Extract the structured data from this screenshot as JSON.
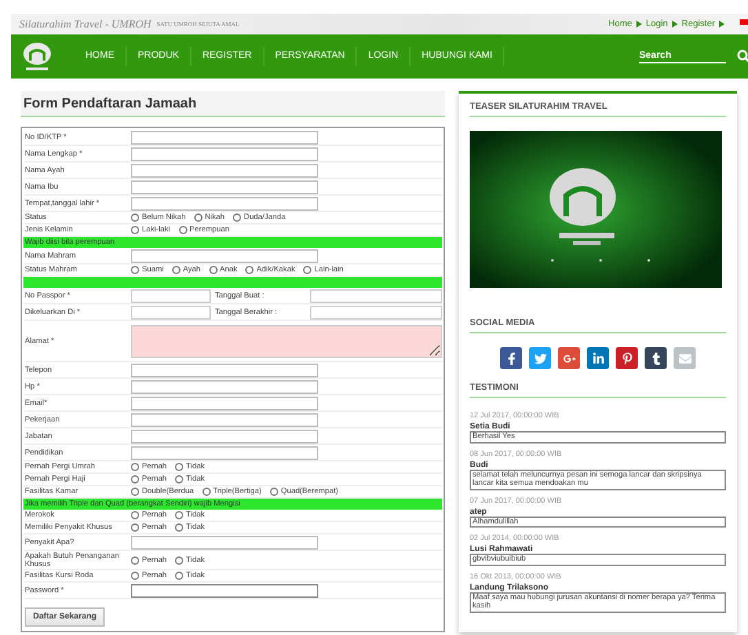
{
  "header": {
    "site_title": "Silaturahim Travel - UMROH",
    "tagline": "SATU UMROH SEJUTA AMAL",
    "top_links": [
      "Home",
      "Login",
      "Register"
    ]
  },
  "nav": {
    "items": [
      "HOME",
      "PRODUK",
      "REGISTER",
      "PERSYARATAN",
      "LOGIN",
      "HUBUNGI KAMI"
    ],
    "search": {
      "placeholder": "Search"
    }
  },
  "form": {
    "title": "Form Pendaftaran Jamaah",
    "rows": [
      {
        "kind": "text",
        "label": "No ID/KTP *"
      },
      {
        "kind": "text",
        "label": "Nama Lengkap *"
      },
      {
        "kind": "text",
        "label": "Nama Ayah"
      },
      {
        "kind": "text",
        "label": "Nama Ibu"
      },
      {
        "kind": "text",
        "label": "Tempat,tanggal lahir *"
      },
      {
        "kind": "radio",
        "label": "Status",
        "options": [
          {
            "label": "Belum Nikah",
            "selected": false
          },
          {
            "label": "Nikah",
            "selected": false
          },
          {
            "label": "Duda/Janda",
            "selected": false
          }
        ]
      },
      {
        "kind": "radio",
        "label": "Jenis Kelamin",
        "options": [
          {
            "label": "Laki-laki",
            "selected": false
          },
          {
            "label": "Perempuan",
            "selected": false
          }
        ]
      },
      {
        "kind": "banner",
        "text": "Wajib diisi bila perempuan"
      },
      {
        "kind": "text",
        "label": "Nama Mahram"
      },
      {
        "kind": "radio",
        "label": "Status Mahram",
        "options": [
          {
            "label": "Suami",
            "selected": false
          },
          {
            "label": "Ayah",
            "selected": false
          },
          {
            "label": "Anak",
            "selected": false
          },
          {
            "label": "Adik/Kakak",
            "selected": false
          },
          {
            "label": "Lain-lain",
            "selected": false
          }
        ]
      },
      {
        "kind": "divider"
      },
      {
        "kind": "pair",
        "label": "No Passpor *",
        "label_2": "Tanggal Buat :"
      },
      {
        "kind": "pair",
        "label": "Dikeluarkan Di *",
        "label_2": "Tanggal Berakhir :"
      },
      {
        "kind": "textarea",
        "label": "Alamat *"
      },
      {
        "kind": "text",
        "label": "Telepon"
      },
      {
        "kind": "text",
        "label": "Hp *"
      },
      {
        "kind": "text",
        "label": "Email*"
      },
      {
        "kind": "text",
        "label": "Pekerjaan"
      },
      {
        "kind": "text",
        "label": "Jabatan"
      },
      {
        "kind": "text",
        "label": "Pendidikan"
      },
      {
        "kind": "radio",
        "label": "Pernah Pergi Umrah",
        "options": [
          {
            "label": "Pernah",
            "selected": false
          },
          {
            "label": "Tidak",
            "selected": false
          }
        ]
      },
      {
        "kind": "radio",
        "label": "Pernah Pergi Haji",
        "options": [
          {
            "label": "Pernah",
            "selected": false
          },
          {
            "label": "Tidak",
            "selected": false
          }
        ]
      },
      {
        "kind": "radio",
        "label": "Fasilitas Kamar",
        "options": [
          {
            "label": "Double(Berdua",
            "selected": false
          },
          {
            "label": "Triple(Bertiga)",
            "selected": false
          },
          {
            "label": "Quad(Berempat)",
            "selected": false
          }
        ]
      },
      {
        "kind": "banner",
        "text": "Jika memilih Triple dan Quad (berangkat Sendiri) wajib Mengisi"
      },
      {
        "kind": "radio",
        "label": "Merokok",
        "options": [
          {
            "label": "Pernah",
            "selected": false
          },
          {
            "label": "Tidak",
            "selected": false
          }
        ]
      },
      {
        "kind": "radio",
        "label": "Memiliki Penyakit Khusus",
        "options": [
          {
            "label": "Pernah",
            "selected": false
          },
          {
            "label": "Tidak",
            "selected": false
          }
        ]
      },
      {
        "kind": "text",
        "label": "Penyakit Apa?"
      },
      {
        "kind": "radio",
        "label": "Apakah Butuh Penanganan Khusus",
        "options": [
          {
            "label": "Pernah",
            "selected": false
          },
          {
            "label": "Tidak",
            "selected": false
          }
        ]
      },
      {
        "kind": "radio",
        "label": "Fasilitas Kursi Roda",
        "options": [
          {
            "label": "Pernah",
            "selected": false
          },
          {
            "label": "Tidak",
            "selected": false
          }
        ]
      },
      {
        "kind": "password",
        "label": "Password *"
      }
    ],
    "submit": "Daftar Sekarang"
  },
  "sidebar": {
    "teaser_title": "TEASER SILATURAHIM TRAVEL",
    "social_title": "SOCIAL MEDIA",
    "social_links": [
      {
        "kind": "facebook",
        "color": "#3b5998"
      },
      {
        "kind": "twitter",
        "color": "#1da1f2"
      },
      {
        "kind": "googleplus",
        "color": "#dd4b39"
      },
      {
        "kind": "linkedin",
        "color": "#0077b5"
      },
      {
        "kind": "pinterest",
        "color": "#cb2027"
      },
      {
        "kind": "tumblr",
        "color": "#35465c"
      },
      {
        "kind": "email",
        "color": "#bcc3c7"
      }
    ],
    "testimoni_title": "TESTIMONI",
    "testimonials": [
      {
        "date": "12 Jul 2017, 00:00:00 WIB",
        "name": "Setia Budi",
        "message": "Berhasil Yes"
      },
      {
        "date": "08 Jun 2017, 00:00:00 WIB",
        "name": "Budi",
        "message": "selamat telah meluncurnya pesan ini semoga lancar dan skripsinya lancar kita semua mendoakan mu"
      },
      {
        "date": "07 Jun 2017, 00:00:00 WIB",
        "name": "atep",
        "message": "Alhamdulillah"
      },
      {
        "date": "02 Jul 2014, 00:00:00 WIB",
        "name": "Lusi Rahmawati",
        "message": "gbvibviubuibiub"
      },
      {
        "date": "16 Okt 2013, 00:00:00 WIB",
        "name": "Landung Trilaksono",
        "message": "Maaf saya mau hubungi jurusan akuntansi di nomer berapa ya? Terima kasih"
      }
    ]
  }
}
